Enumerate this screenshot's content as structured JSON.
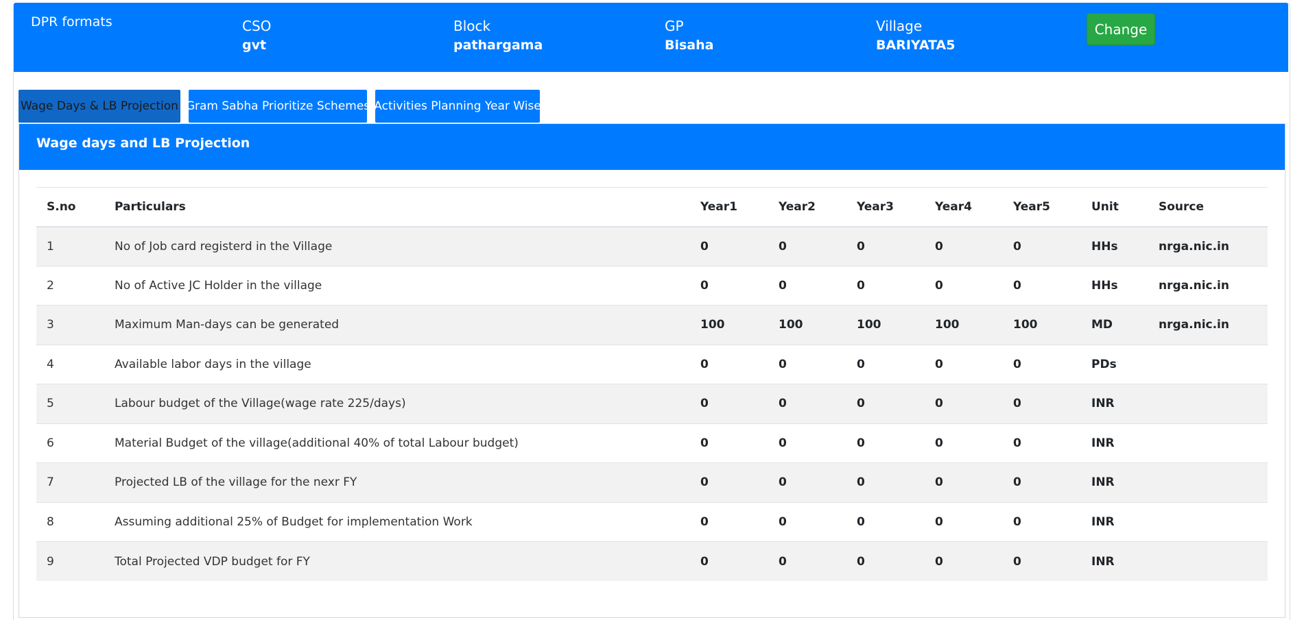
{
  "header": {
    "brand": "DPR formats",
    "fields": [
      {
        "label": "CSO",
        "value": "gvt"
      },
      {
        "label": "Block",
        "value": "pathargama"
      },
      {
        "label": "GP",
        "value": "Bisaha"
      },
      {
        "label": "Village",
        "value": "BARIYATA5"
      }
    ],
    "change_label": "Change"
  },
  "colors": {
    "primary": "#007bff",
    "success": "#28a745",
    "active_tab": "#1167c5"
  },
  "tabs": [
    {
      "label": "Wage Days & LB Projection",
      "active": true
    },
    {
      "label": "Gram Sabha Prioritize Schemes",
      "active": false
    },
    {
      "label": "Activities Planning Year Wise",
      "active": false
    }
  ],
  "panel": {
    "title": "Wage days and LB Projection",
    "table": {
      "columns": [
        "S.no",
        "Particulars",
        "Year1",
        "Year2",
        "Year3",
        "Year4",
        "Year5",
        "Unit",
        "Source"
      ],
      "rows": [
        [
          "1",
          "No of Job card registerd in the Village",
          "0",
          "0",
          "0",
          "0",
          "0",
          "HHs",
          "nrga.nic.in"
        ],
        [
          "2",
          "No of Active JC Holder in the village",
          "0",
          "0",
          "0",
          "0",
          "0",
          "HHs",
          "nrga.nic.in"
        ],
        [
          "3",
          "Maximum Man-days can be generated",
          "100",
          "100",
          "100",
          "100",
          "100",
          "MD",
          "nrga.nic.in"
        ],
        [
          "4",
          "Available labor days in the village",
          "0",
          "0",
          "0",
          "0",
          "0",
          "PDs",
          ""
        ],
        [
          "5",
          "Labour budget of the Village(wage rate 225/days)",
          "0",
          "0",
          "0",
          "0",
          "0",
          "INR",
          ""
        ],
        [
          "6",
          "Material Budget of the village(additional 40% of total Labour budget)",
          "0",
          "0",
          "0",
          "0",
          "0",
          "INR",
          ""
        ],
        [
          "7",
          "Projected LB of the village for the nexr FY",
          "0",
          "0",
          "0",
          "0",
          "0",
          "INR",
          ""
        ],
        [
          "8",
          "Assuming additional 25% of Budget for implementation Work",
          "0",
          "0",
          "0",
          "0",
          "0",
          "INR",
          ""
        ],
        [
          "9",
          "Total Projected VDP budget for FY",
          "0",
          "0",
          "0",
          "0",
          "0",
          "INR",
          ""
        ]
      ]
    }
  }
}
